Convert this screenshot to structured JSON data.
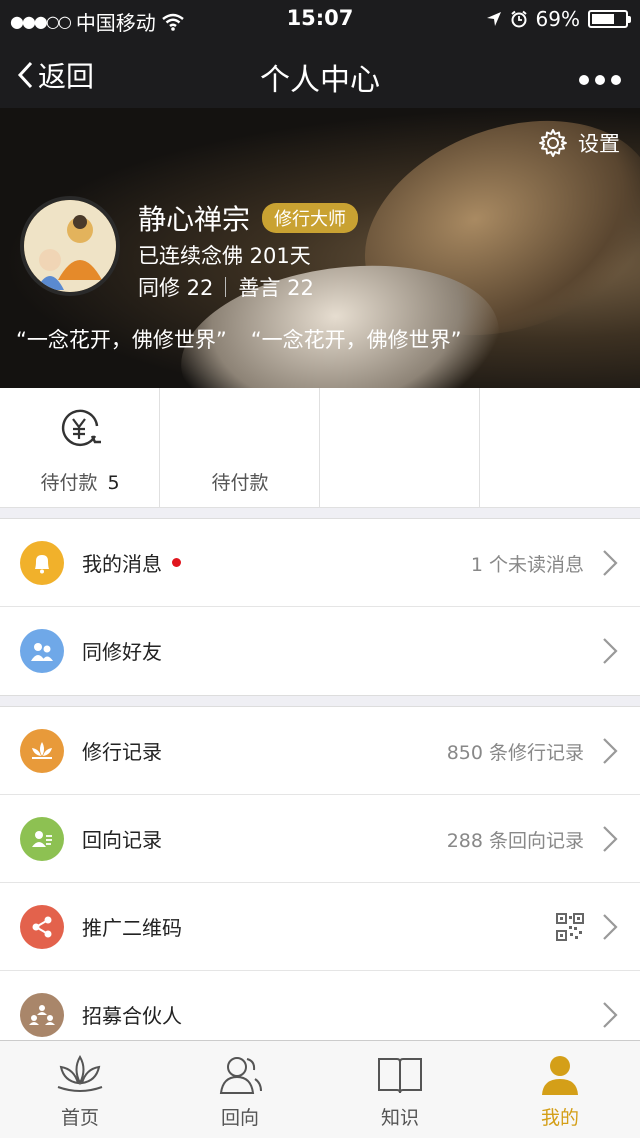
{
  "status_bar": {
    "carrier": "中国移动",
    "time": "15:07",
    "battery_percent": "69%",
    "battery_level": 0.69
  },
  "nav": {
    "back_label": "返回",
    "title": "个人中心"
  },
  "profile": {
    "settings_label": "设置",
    "name": "静心禅宗",
    "badge": "修行大师",
    "streak": "已连续念佛 201天",
    "fellow_label": "同修 22",
    "words_label": "善言 22",
    "quote_1": "“一念花开，佛修世界”",
    "quote_2": "“一念花开，佛修世界”"
  },
  "orders": {
    "cells": [
      {
        "label": "待付款",
        "count": "5"
      },
      {
        "label": "待付款"
      },
      {},
      {}
    ]
  },
  "group1": [
    {
      "label": "我的消息",
      "value": "1 个未读消息",
      "color": "#f1b12b"
    },
    {
      "label": "同修好友",
      "color": "#6fa8e8"
    }
  ],
  "group2": [
    {
      "label": "修行记录",
      "value": "850 条修行记录",
      "color": "#e89a3a"
    },
    {
      "label": "回向记录",
      "value": "288 条回向记录",
      "color": "#8dc152"
    },
    {
      "label": "推广二维码",
      "color": "#e3624c"
    },
    {
      "label": "招募合伙人",
      "color": "#a9866a"
    }
  ],
  "tabs": [
    {
      "label": "首页"
    },
    {
      "label": "回向"
    },
    {
      "label": "知识"
    },
    {
      "label": "我的"
    }
  ],
  "accent_color": "#d49f18"
}
